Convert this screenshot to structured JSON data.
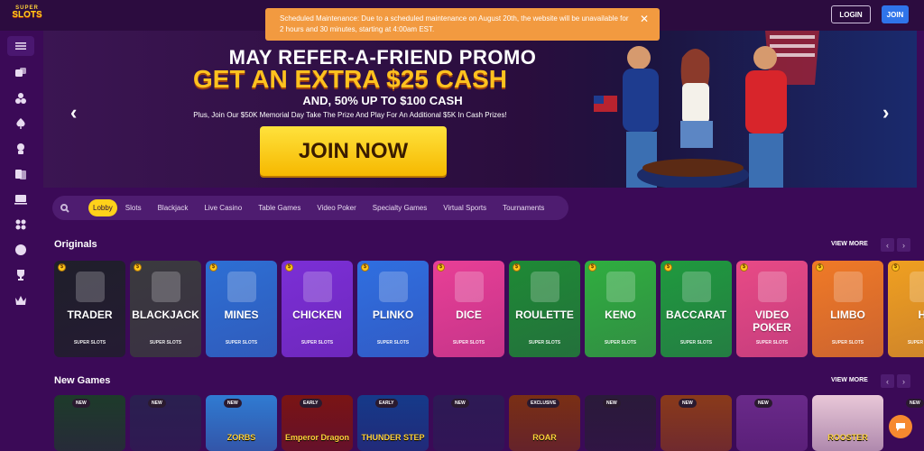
{
  "logo": {
    "line1": "SUPER",
    "line2": "SLOTS"
  },
  "header": {
    "login_label": "LOGIN",
    "join_label": "JOIN"
  },
  "notice": {
    "text": "Scheduled Maintenance: Due to a scheduled maintenance on August 20th, the website will be unavailable for 2 hours and 30 minutes, starting at 4:00am EST.",
    "close_icon": "✕"
  },
  "sidebar": {
    "items": [
      "menu-icon",
      "dice-icon",
      "poker-chips-icon",
      "spade-icon",
      "dealer-icon",
      "cards-icon",
      "monitor-icon",
      "grid-icon",
      "basketball-icon",
      "trophy-icon",
      "crown-icon"
    ]
  },
  "hero": {
    "line1": "MAY REFER-A-FRIEND PROMO",
    "line2": "GET AN EXTRA $25 CASH",
    "line3": "AND, 50% UP TO $100 CASH",
    "line4": "Plus, Join Our $50K Memorial Day Take The Prize And Play For An Additional $5K In Cash Prizes!",
    "cta": "JOIN NOW",
    "prev": "‹",
    "next": "›"
  },
  "filters": {
    "tabs": [
      "Lobby",
      "Slots",
      "Blackjack",
      "Live Casino",
      "Table Games",
      "Video Poker",
      "Specialty Games",
      "Virtual Sports",
      "Tournaments"
    ],
    "active": "Lobby"
  },
  "originals": {
    "title": "Originals",
    "view_more": "VIEW MORE",
    "prev": "‹",
    "next": "›",
    "brand": "SUPER SLOTS",
    "games": [
      {
        "name": "TRADER",
        "color": "#1f1f2a"
      },
      {
        "name": "BLACKJACK",
        "color": "#3a3a3e"
      },
      {
        "name": "MINES",
        "color": "#2d6fd4"
      },
      {
        "name": "CHICKEN",
        "color": "#7b2fd6"
      },
      {
        "name": "PLINKO",
        "color": "#2f6fe0"
      },
      {
        "name": "DICE",
        "color": "#e83f96"
      },
      {
        "name": "ROULETTE",
        "color": "#1e8a35"
      },
      {
        "name": "KENO",
        "color": "#2fae3f"
      },
      {
        "name": "BACCARAT",
        "color": "#1f9a3e"
      },
      {
        "name": "VIDEO POKER",
        "color": "#e84a86"
      },
      {
        "name": "LIMBO",
        "color": "#f07a26"
      },
      {
        "name": "HI",
        "color": "#f0a020"
      }
    ]
  },
  "new_games": {
    "title": "New Games",
    "view_more": "VIEW MORE",
    "prev": "‹",
    "next": "›",
    "games": [
      {
        "badge": "NEW",
        "title": "",
        "color": "#1d3b2a"
      },
      {
        "badge": "NEW",
        "title": "",
        "color": "#2a2050"
      },
      {
        "badge": "NEW",
        "title": "ZORBS",
        "color": "#2f7bd2"
      },
      {
        "badge": "EARLY",
        "title": "Emperor Dragon",
        "color": "#7a1414"
      },
      {
        "badge": "EARLY",
        "title": "THUNDER STEP",
        "color": "#153a8a"
      },
      {
        "badge": "NEW",
        "title": "",
        "color": "#2d1a55"
      },
      {
        "badge": "EXCLUSIVE",
        "title": "ROAR",
        "color": "#7a2f14"
      },
      {
        "badge": "NEW",
        "title": "",
        "color": "#2a1a3a"
      },
      {
        "badge": "NEW",
        "title": "",
        "color": "#8a3a1a"
      },
      {
        "badge": "NEW",
        "title": "",
        "color": "#6a2a8a"
      },
      {
        "badge": "",
        "title": "ROOSTER",
        "color": "#e9c8d8"
      },
      {
        "badge": "NEW",
        "title": "",
        "color": "#222"
      }
    ]
  },
  "chat": {
    "icon": "chat-bubble-icon"
  }
}
